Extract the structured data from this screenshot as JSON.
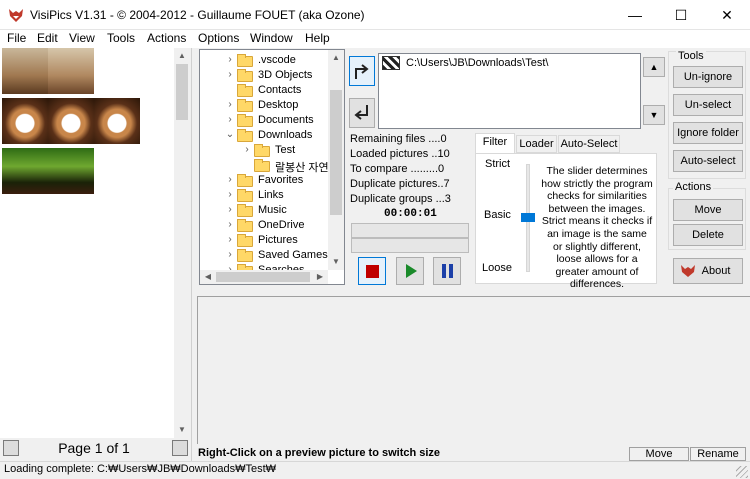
{
  "window": {
    "title": "VisiPics V1.31 - © 2004-2012 - Guillaume FOUET (aka Ozone)",
    "minimize": "—",
    "maximize": "☐",
    "close": "✕"
  },
  "menu": [
    "File",
    "Edit",
    "View",
    "Tools",
    "Actions",
    "Options",
    "Window",
    "Help"
  ],
  "pager": {
    "label": "Page 1 of 1"
  },
  "tree": [
    {
      "label": ".vscode",
      "indent": 0,
      "expanded": false
    },
    {
      "label": "3D Objects",
      "indent": 0,
      "expanded": false
    },
    {
      "label": "Contacts",
      "indent": 0,
      "expanded": false
    },
    {
      "label": "Desktop",
      "indent": 0,
      "expanded": false
    },
    {
      "label": "Documents",
      "indent": 0,
      "expanded": false
    },
    {
      "label": "Downloads",
      "indent": 0,
      "expanded": true
    },
    {
      "label": "Test",
      "indent": 1,
      "expanded": false
    },
    {
      "label": "랄봉산 자연",
      "indent": 1,
      "expanded": false
    },
    {
      "label": "Favorites",
      "indent": 0,
      "expanded": false
    },
    {
      "label": "Links",
      "indent": 0,
      "expanded": false
    },
    {
      "label": "Music",
      "indent": 0,
      "expanded": false
    },
    {
      "label": "OneDrive",
      "indent": 0,
      "expanded": false
    },
    {
      "label": "Pictures",
      "indent": 0,
      "expanded": false
    },
    {
      "label": "Saved Games",
      "indent": 0,
      "expanded": false
    },
    {
      "label": "Searches",
      "indent": 0,
      "expanded": false
    }
  ],
  "path": {
    "value": "C:\\Users\\JB\\Downloads\\Test\\"
  },
  "stats": {
    "remaining": "Remaining files ....0",
    "loaded": "Loaded pictures ..10",
    "compare": "To compare .........0",
    "duplicates": "Duplicate pictures..7",
    "groups": "Duplicate groups ...3",
    "timer": "00:00:01"
  },
  "tabs": {
    "filter": "Filter",
    "loader": "Loader",
    "autoselect": "Auto-Select"
  },
  "slider": {
    "strict": "Strict",
    "basic": "Basic",
    "loose": "Loose",
    "level": "Basic"
  },
  "filter_text": "The slider determines how strictly the program checks for similarities between the images. Strict means it checks if an image is the same or slightly different, loose allows for a greater amount of differences.",
  "tools": {
    "heading": "Tools",
    "unignore": "Un-ignore",
    "unselect": "Un-select",
    "ignore_folder": "Ignore folder",
    "autoselect": "Auto-select"
  },
  "actions": {
    "heading": "Actions",
    "move": "Move",
    "delete": "Delete",
    "about": "About"
  },
  "bottom": {
    "hint": "Right-Click on a preview picture to switch size",
    "move": "Move",
    "rename": "Rename"
  },
  "status": {
    "text": "Loading complete: C:₩Users₩JB₩Downloads₩Test₩"
  },
  "colors": {
    "accent": "#0078d7",
    "stop": "#c00000",
    "play": "#1a8a2a",
    "pause": "#1b3fa8",
    "folder": "#ffd867"
  }
}
